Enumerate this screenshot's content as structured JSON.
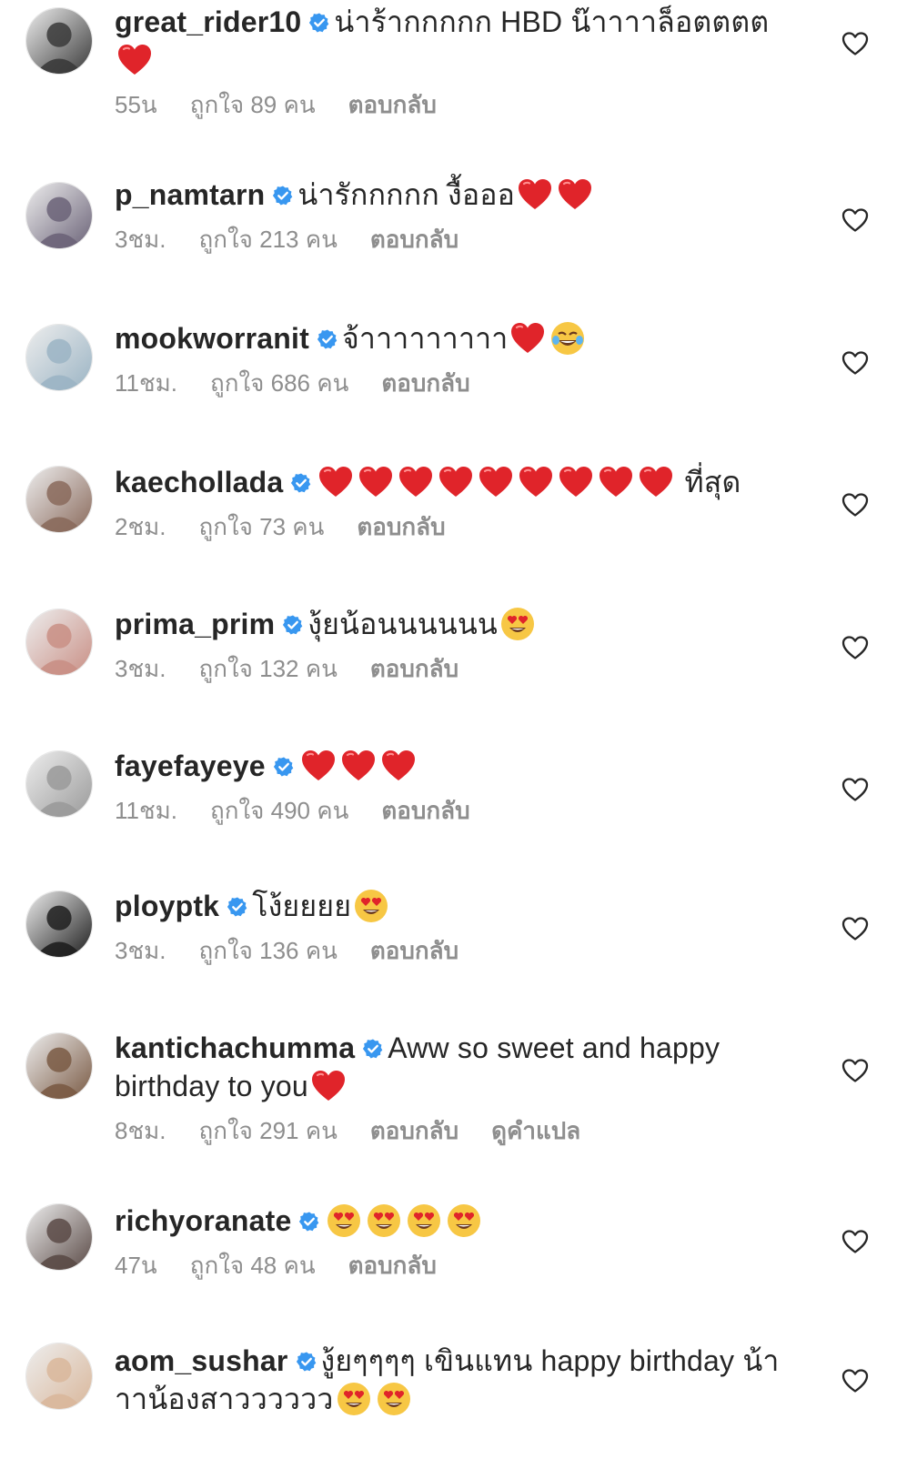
{
  "labels": {
    "reply": "ตอบกลับ",
    "see_translation": "ดูคำแปล"
  },
  "comments": [
    {
      "username": "great_rider10",
      "text_before": "น่าร้ากกกกก HBD น๊าาาาล็อตตตต",
      "emojis_after": [
        "heart"
      ],
      "time": "55น",
      "likes": "ถูกใจ 89 คน",
      "avatar_color": "#3a3a3a"
    },
    {
      "username": "p_namtarn",
      "text_before": "น่ารักกกกก งื้อออ",
      "emojis_after": [
        "heart",
        "heart"
      ],
      "time": "3ชม.",
      "likes": "ถูกใจ 213 คน",
      "avatar_color": "#6b6378"
    },
    {
      "username": "mookworranit",
      "text_before": "จ้าาาาาาาาา",
      "emojis_after": [
        "heart",
        "joy"
      ],
      "time": "11ชม.",
      "likes": "ถูกใจ 686 คน",
      "avatar_color": "#9bb4c4"
    },
    {
      "username": "kaechollada",
      "text_before": "",
      "emojis_after": [
        "heart",
        "heart",
        "heart",
        "heart",
        "heart",
        "heart",
        "heart",
        "heart",
        "heart"
      ],
      "text_after": " ที่สุด",
      "time": "2ชม.",
      "likes": "ถูกใจ 73 คน",
      "avatar_color": "#8a6a5c"
    },
    {
      "username": "prima_prim",
      "text_before": "งุ้ยน้อนนนนนน",
      "emojis_after": [
        "hearteyes"
      ],
      "time": "3ชม.",
      "likes": "ถูกใจ 132 คน",
      "avatar_color": "#c98f85"
    },
    {
      "username": "fayefayeye",
      "text_before": "",
      "emojis_after": [
        "heart",
        "heart",
        "heart"
      ],
      "time": "11ชม.",
      "likes": "ถูกใจ 490 คน",
      "avatar_color": "#9a9a9a"
    },
    {
      "username": "ploypt k",
      "text_before": "โง้ยยยย",
      "emojis_after": [
        "hearteyes"
      ],
      "time": "3ชม.",
      "likes": "ถูกใจ 136 คน",
      "avatar_color": "#1e1e1e"
    },
    {
      "username": "kantichachumma",
      "text_before": "Aww so sweet and happy birthday to you",
      "emojis_after": [
        "heart"
      ],
      "time": "8ชม.",
      "likes": "ถูกใจ 291 คน",
      "translate": true,
      "avatar_color": "#7a5a44"
    },
    {
      "username": "richyoranate",
      "text_before": "",
      "emojis_after": [
        "hearteyes",
        "hearteyes",
        "hearteyes",
        "hearteyes"
      ],
      "time": "47น",
      "likes": "ถูกใจ 48 คน",
      "avatar_color": "#5a4a46"
    },
    {
      "username": "aom_sushar",
      "text_before": "งู้ยๆๆๆๆ เขินแทน happy birthday น้าาาน้องสาวววววว",
      "emojis_after": [
        "hearteyes",
        "hearteyes"
      ],
      "avatar_color": "#d9b79b"
    }
  ]
}
